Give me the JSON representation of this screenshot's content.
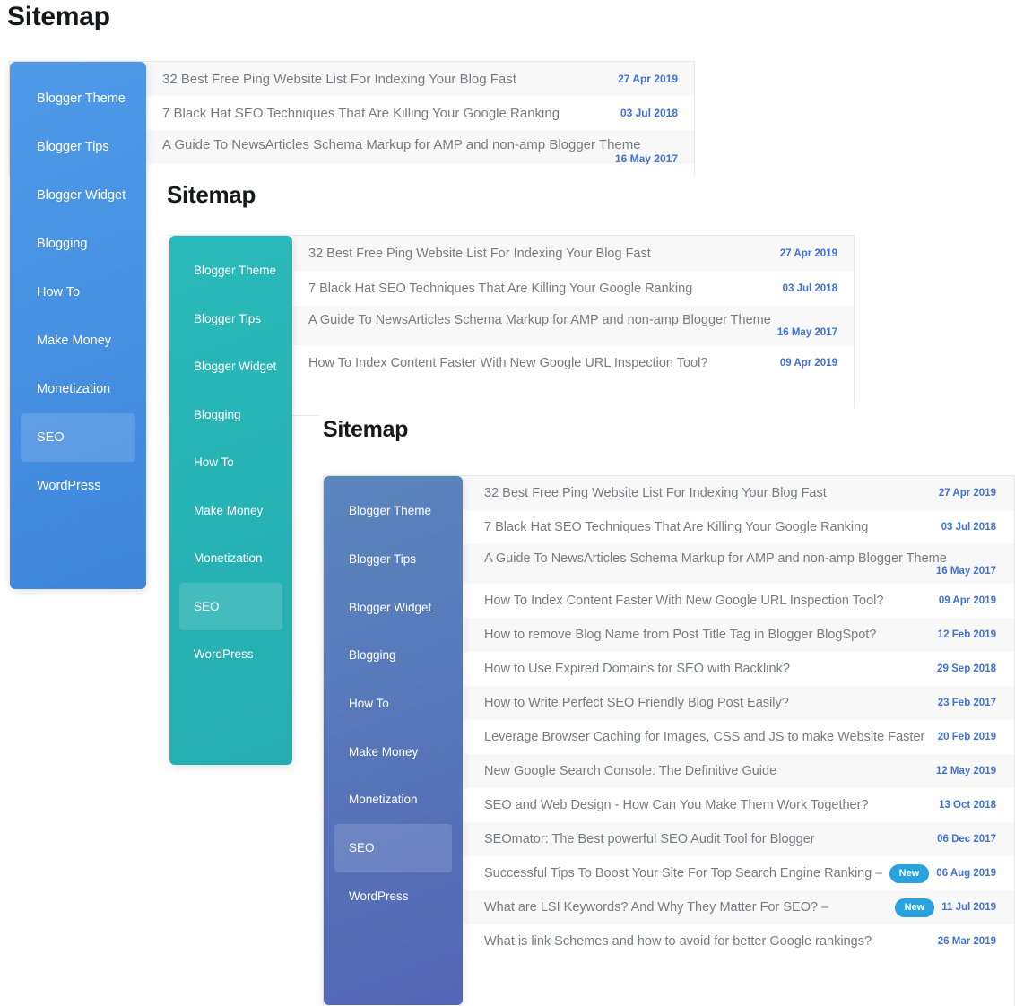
{
  "page": {
    "title": "Sitemap",
    "background": "#ffffff"
  },
  "categories": [
    {
      "label": "Blogger Theme",
      "active": false
    },
    {
      "label": "Blogger Tips",
      "active": false
    },
    {
      "label": "Blogger Widget",
      "active": false
    },
    {
      "label": "Blogging",
      "active": false
    },
    {
      "label": "How To",
      "active": false
    },
    {
      "label": "Make Money",
      "active": false
    },
    {
      "label": "Monetization",
      "active": false
    },
    {
      "label": "SEO",
      "active": true
    },
    {
      "label": "WordPress",
      "active": false
    }
  ],
  "posts": [
    {
      "title": "32 Best Free Ping Website List For Indexing Your Blog Fast",
      "date": "27 Apr 2019",
      "badge": null
    },
    {
      "title": "7 Black Hat SEO Techniques That Are Killing Your Google Ranking",
      "date": "03 Jul 2018",
      "badge": null
    },
    {
      "title": "A Guide To NewsArticles Schema Markup for AMP and non-amp Blogger Theme",
      "date": "16 May 2017",
      "badge": null,
      "wrap": true
    },
    {
      "title": "How To Index Content Faster With New Google URL Inspection Tool?",
      "date": "09 Apr 2019",
      "badge": null
    },
    {
      "title": "How to remove Blog Name from Post Title Tag in Blogger BlogSpot?",
      "date": "12 Feb 2019",
      "badge": null
    },
    {
      "title": "How to Use Expired Domains for SEO with Backlink?",
      "date": "29 Sep 2018",
      "badge": null
    },
    {
      "title": "How to Write Perfect SEO Friendly Blog Post Easily?",
      "date": "23 Feb 2017",
      "badge": null
    },
    {
      "title": "Leverage Browser Caching for Images, CSS and JS to make Website Faster",
      "date": "20 Feb 2019",
      "badge": null
    },
    {
      "title": "New Google Search Console: The Definitive Guide",
      "date": "12 May 2019",
      "badge": null
    },
    {
      "title": "SEO and Web Design - How Can You Make Them Work Together?",
      "date": "13 Oct 2018",
      "badge": null
    },
    {
      "title": "SEOmator: The Best powerful SEO Audit Tool for Blogger",
      "date": "06 Dec 2017",
      "badge": null
    },
    {
      "title": "Successful Tips To Boost Your Site For Top Search Engine Ranking –",
      "date": "06 Aug 2019",
      "badge": "New"
    },
    {
      "title": "What are LSI Keywords? And Why They Matter For SEO? –",
      "date": "11 Jul 2019",
      "badge": "New"
    },
    {
      "title": "What is link Schemes and how to avoid for better Google rankings?",
      "date": "26 Mar 2019",
      "badge": null
    }
  ],
  "panels": [
    {
      "id": "panel-blue",
      "title": "Sitemap",
      "accent_from": "#4f9ae8",
      "accent_to": "#3f86db",
      "visible_post_count": 3
    },
    {
      "id": "panel-teal",
      "title": "Sitemap",
      "accent_from": "#2ab9b9",
      "accent_to": "#24aeb0",
      "visible_post_count": 4
    },
    {
      "id": "panel-indigo",
      "title": "Sitemap",
      "accent_from": "#5a86bd",
      "accent_to": "#5466b6",
      "visible_post_count": 14
    }
  ],
  "colors": {
    "date_text": "#4072d4",
    "row_title_text": "#777b80",
    "row_odd_bg": "#f8f8f8",
    "row_even_bg": "#ffffff",
    "badge_bg": "#29a3df",
    "badge_text": "#ffffff",
    "panel_border": "#e7e7e7",
    "heading_text": "#16181c"
  }
}
